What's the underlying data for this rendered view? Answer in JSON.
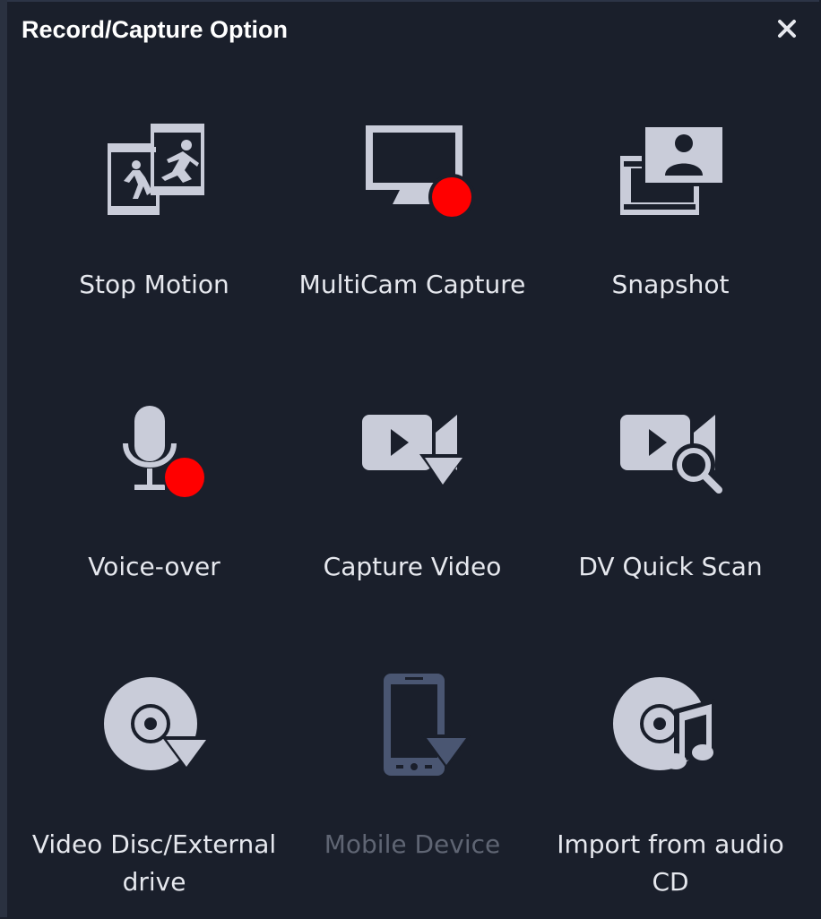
{
  "dialog": {
    "title": "Record/Capture Option",
    "close_icon": "close-icon"
  },
  "options": [
    {
      "label": "Stop Motion",
      "icon": "stop-motion-icon",
      "enabled": true
    },
    {
      "label": "MultiCam Capture",
      "icon": "monitor-record-icon",
      "enabled": true
    },
    {
      "label": "Snapshot",
      "icon": "snapshot-icon",
      "enabled": true
    },
    {
      "label": "Voice-over",
      "icon": "microphone-record-icon",
      "enabled": true
    },
    {
      "label": "Capture Video",
      "icon": "capture-video-icon",
      "enabled": true
    },
    {
      "label": "DV Quick Scan",
      "icon": "dv-scan-icon",
      "enabled": true
    },
    {
      "label": "Video Disc/External drive",
      "icon": "disc-download-icon",
      "enabled": true
    },
    {
      "label": "Mobile Device",
      "icon": "mobile-download-icon",
      "enabled": false
    },
    {
      "label": "Import from audio CD",
      "icon": "audio-cd-icon",
      "enabled": true
    }
  ],
  "colors": {
    "background": "#1a1f2b",
    "icon": "#c9ccd9",
    "icon_disabled": "#4a5672",
    "record_dot": "#ff0000",
    "label": "#e6e8ee",
    "label_disabled": "#5f6573"
  }
}
